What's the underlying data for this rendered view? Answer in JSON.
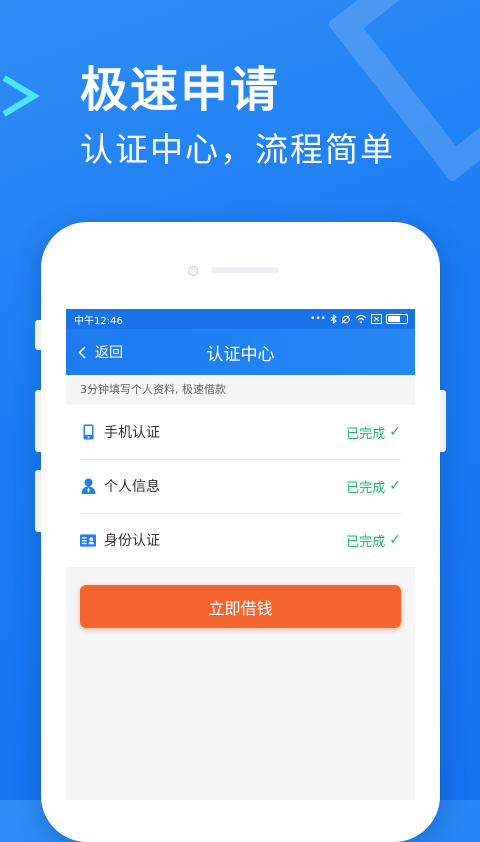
{
  "hero": {
    "headline": "极速申请",
    "subline": "认证中心，流程简单"
  },
  "status_bar": {
    "time": "中午12:46",
    "icons": [
      "dots-icon",
      "bluetooth-icon",
      "alarm-icon",
      "wifi-icon",
      "sim-icon",
      "battery-icon"
    ]
  },
  "navbar": {
    "back_label": "返回",
    "title": "认证中心"
  },
  "tip": "3分钟填写个人资料, 极速借款",
  "items": [
    {
      "label": "手机认证",
      "status": "已完成",
      "icon": "phone-icon"
    },
    {
      "label": "个人信息",
      "status": "已完成",
      "icon": "person-icon"
    },
    {
      "label": "身份认证",
      "status": "已完成",
      "icon": "id-card-icon"
    }
  ],
  "check_mark": "✓",
  "cta_label": "立即借钱",
  "colors": {
    "background": "#1a7cf2",
    "accent": "#1d7bef",
    "done": "#23b26b",
    "button": "#f5652f"
  }
}
